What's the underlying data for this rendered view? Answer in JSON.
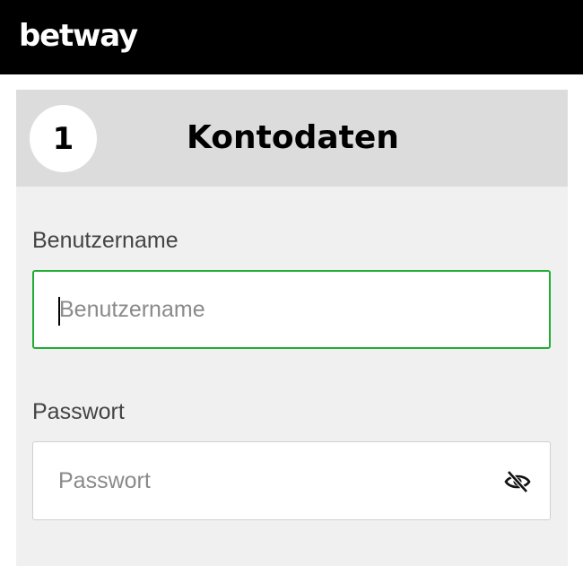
{
  "header": {
    "logo_text": "betway"
  },
  "section": {
    "step_number": "1",
    "title": "Kontodaten"
  },
  "form": {
    "username": {
      "label": "Benutzername",
      "placeholder": "Benutzername",
      "value": ""
    },
    "password": {
      "label": "Passwort",
      "placeholder": "Passwort",
      "value": "",
      "toggle_icon": "eye-slash-icon"
    }
  },
  "colors": {
    "header_bg": "#000000",
    "panel_header_bg": "#dcdcdc",
    "panel_bg": "#f0f0f0",
    "focus_border": "#1fad34"
  }
}
